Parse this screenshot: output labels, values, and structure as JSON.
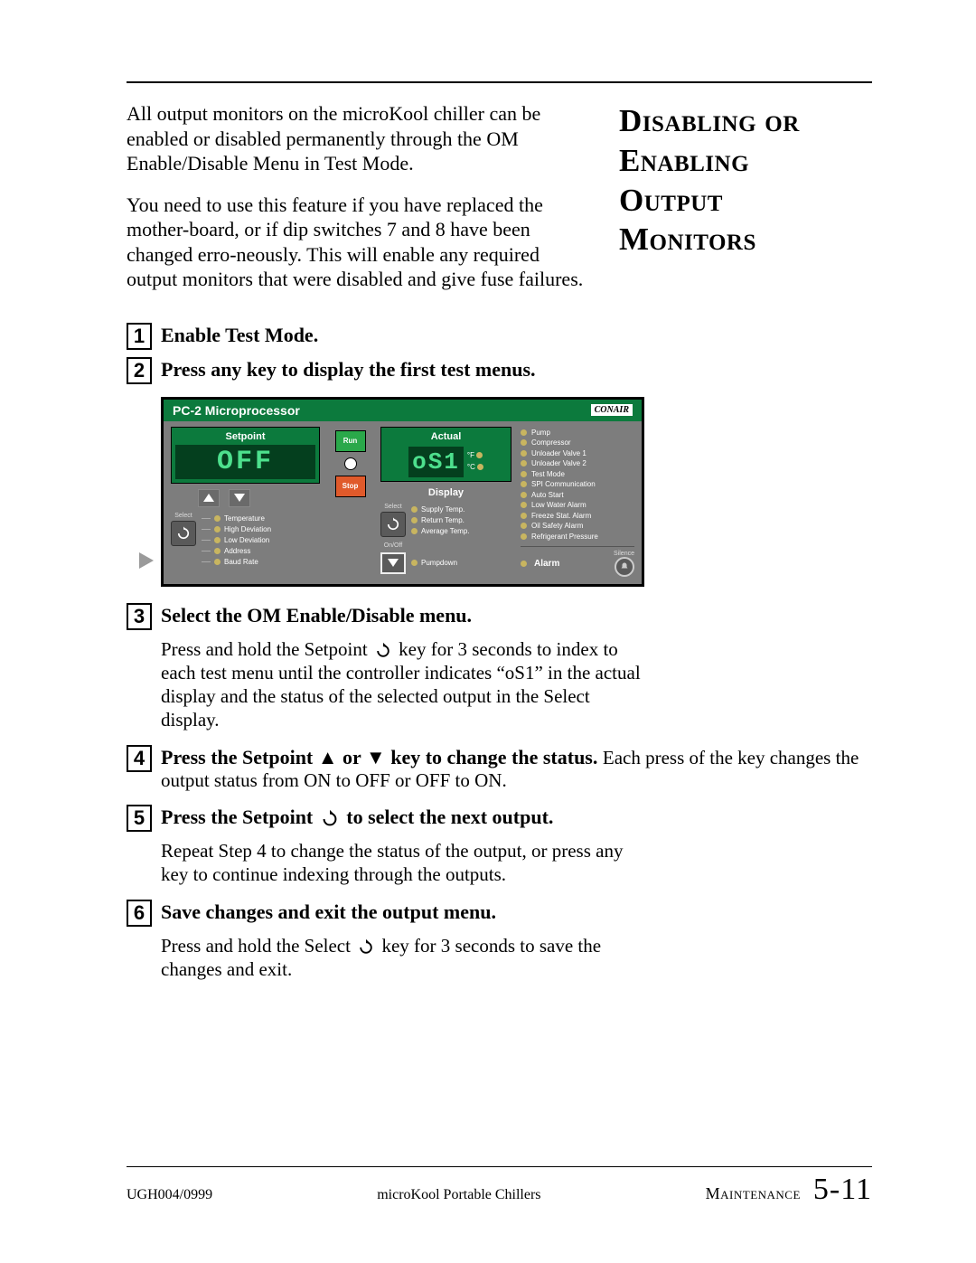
{
  "title_lines": [
    "Disabling or",
    "Enabling",
    "Output",
    "Monitors"
  ],
  "intro": {
    "p1": "All output monitors on the microKool chiller can be enabled or disabled permanently through the OM Enable/Disable Menu in Test Mode.",
    "p2": "You need to use this feature if you have replaced the mother-board, or if dip switches 7 and 8 have been changed erro-neously. This will enable any required output monitors that were disabled and give fuse failures."
  },
  "steps": {
    "s1": {
      "num": "1",
      "title": "Enable Test Mode."
    },
    "s2": {
      "num": "2",
      "title": "Press any key to display the first test menus."
    },
    "s3": {
      "num": "3",
      "title": "Select the OM Enable/Disable menu.",
      "body_a": "Press and hold the Setpoint ",
      "body_b": " key for 3 seconds to index to  each test menu until the controller indicates “oS1” in the actual display and the status of the selected output in the Select display."
    },
    "s4": {
      "num": "4",
      "title_a": "Press the Setpoint ",
      "title_b": " or ",
      "title_c": " key to change the status.",
      "body": " Each press of the key changes the output status from ON to OFF or OFF to ON."
    },
    "s5": {
      "num": "5",
      "title_a": "Press the Setpoint ",
      "title_b": " to select the next output.",
      "body": "Repeat Step 4 to change the status of the output, or press any key to continue indexing through the outputs."
    },
    "s6": {
      "num": "6",
      "title": "Save changes and exit the output menu.",
      "body_a": "Press and hold the Select ",
      "body_b": " key for 3 seconds to save the changes and exit."
    }
  },
  "panel": {
    "header": "PC-2 Microprocessor",
    "brand": "CONAIR",
    "setpoint_label": "Setpoint",
    "setpoint_value": "OFF",
    "actual_label": "Actual",
    "actual_value": "oS1",
    "deg_f": "°F",
    "deg_c": "°C",
    "run": "Run",
    "stop": "Stop",
    "display_label": "Display",
    "select_label": "Select",
    "onoff_label": "On/Off",
    "silence_label": "Silence",
    "alarm_label": "Alarm",
    "pumpdown": "Pumpdown",
    "setpoint_items": [
      "Temperature",
      "High Deviation",
      "Low Deviation",
      "Address",
      "Baud Rate"
    ],
    "display_items": [
      "Supply Temp.",
      "Return Temp.",
      "Average Temp."
    ],
    "status_items": [
      "Pump",
      "Compressor",
      "Unloader Valve 1",
      "Unloader Valve 2",
      "Test Mode",
      "SPI Communication",
      "Auto Start",
      "Low Water Alarm",
      "Freeze Stat. Alarm",
      "Oil Safety Alarm",
      "Refrigerant Pressure"
    ]
  },
  "footer": {
    "left": "UGH004/0999",
    "center": "microKool Portable Chillers",
    "section": "Maintenance",
    "page": "5-11"
  },
  "icons": {
    "cycle": "cycle-icon",
    "up": "▲",
    "down": "▼"
  }
}
